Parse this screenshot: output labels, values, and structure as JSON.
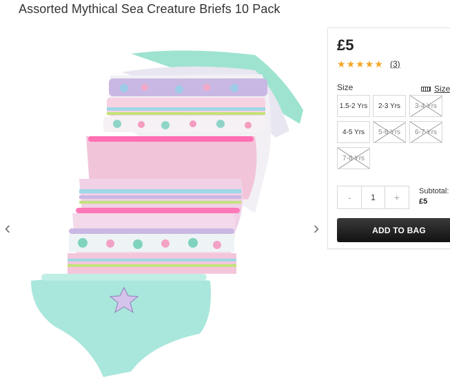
{
  "product": {
    "title": "Assorted Mythical Sea Creature Briefs 10 Pack",
    "price": "£5",
    "rating": 5,
    "rating_count": "(3)",
    "size_label": "Size",
    "size_guide_label": "Size",
    "sizes": [
      {
        "label": "1.5-2 Yrs",
        "available": true
      },
      {
        "label": "2-3 Yrs",
        "available": true
      },
      {
        "label": "3-4 Yrs",
        "available": false
      },
      {
        "label": "4-5 Yrs",
        "available": true
      },
      {
        "label": "5-6 Yrs",
        "available": false
      },
      {
        "label": "6-7 Yrs",
        "available": false
      },
      {
        "label": "7-8 Yrs",
        "available": false
      }
    ],
    "quantity": "1",
    "qty_minus": "-",
    "qty_plus": "+",
    "subtotal_label": "Subtotal:",
    "subtotal_value": "£5",
    "add_to_bag": "ADD TO BAG"
  },
  "gallery": {
    "prev_icon": "chevron-left-icon",
    "next_icon": "chevron-right-icon"
  },
  "colors": {
    "star": "#f5a623",
    "button_bg": "#1a1a1a"
  }
}
